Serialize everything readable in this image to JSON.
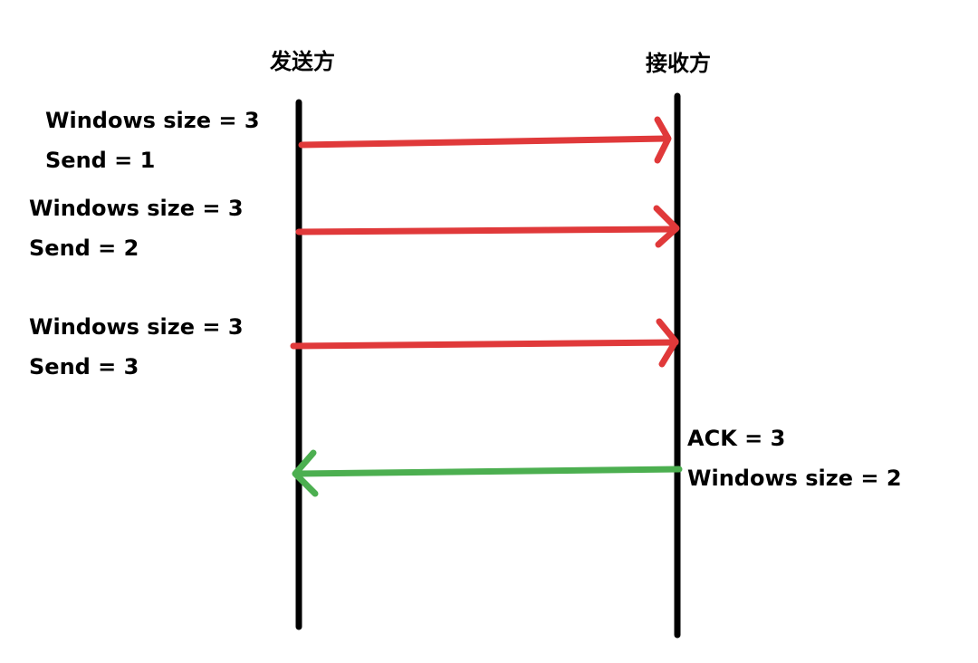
{
  "diagram": {
    "sender_label": "发送方",
    "receiver_label": "接收方",
    "messages": [
      {
        "direction": "send",
        "line1": "Windows size = 3",
        "line2": "Send = 1"
      },
      {
        "direction": "send",
        "line1": "Windows size = 3",
        "line2": "Send = 2"
      },
      {
        "direction": "send",
        "line1": "Windows size = 3",
        "line2": "Send = 3"
      },
      {
        "direction": "ack",
        "line1": "ACK = 3",
        "line2": "Windows size = 2"
      }
    ],
    "colors": {
      "lifeline": "#000000",
      "send_arrow": "#e0393a",
      "ack_arrow": "#4caf50",
      "background": "#ffffff"
    }
  }
}
